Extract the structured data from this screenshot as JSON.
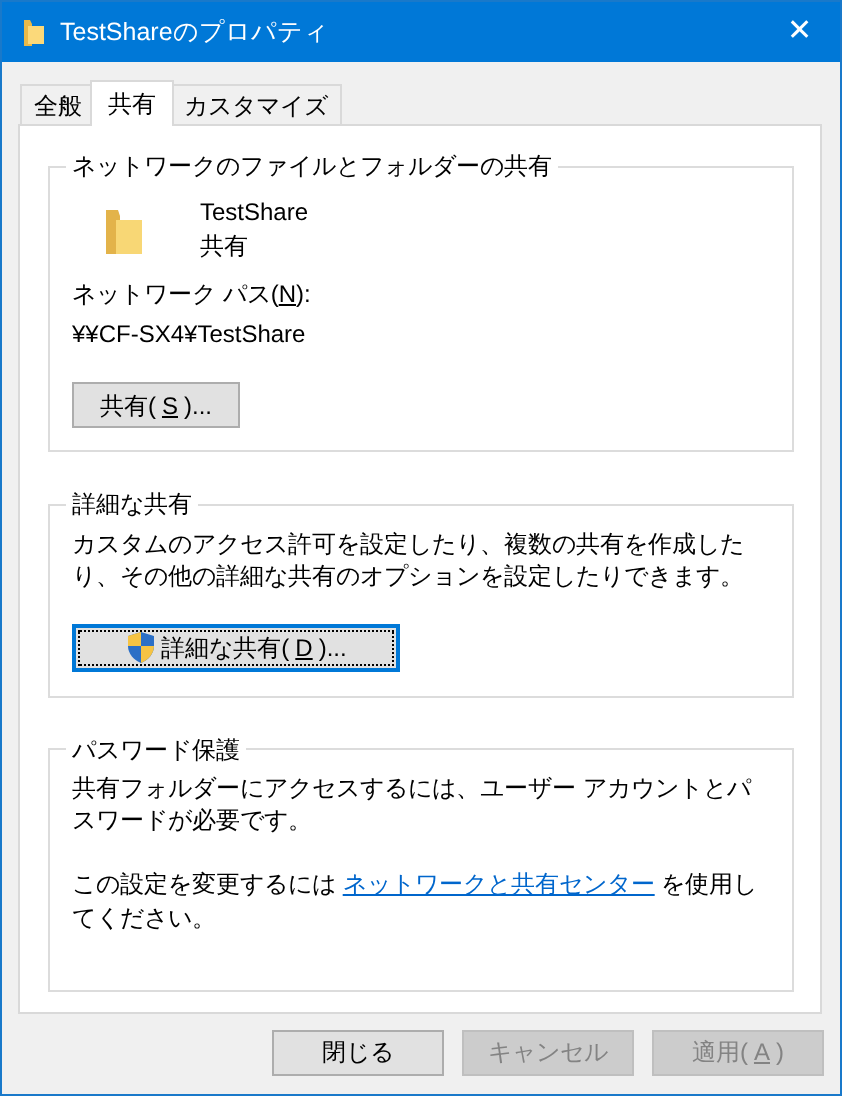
{
  "window": {
    "title": "TestShareのプロパティ",
    "close": "✕"
  },
  "tabs": [
    {
      "label": "全般",
      "selected": false
    },
    {
      "label": "共有",
      "selected": true
    },
    {
      "label": "カスタマイズ",
      "selected": false
    }
  ],
  "network_sharing": {
    "heading": "ネットワークのファイルとフォルダーの共有",
    "folder_name": "TestShare",
    "share_status": "共有",
    "path_label": {
      "before": "ネットワーク パス(",
      "key": "N",
      "after": "):"
    },
    "path": "¥¥CF-SX4¥TestShare",
    "button": {
      "before": "共有(",
      "key": "S",
      "after": ")...",
      "focused": false
    }
  },
  "advanced_sharing": {
    "heading": "詳細な共有",
    "description": "カスタムのアクセス許可を設定したり、複数の共有を作成したり、その他の詳細な共有のオプションを設定したりできます。",
    "button": {
      "before": "詳細な共有(",
      "key": "D",
      "after": ")...",
      "focused": true
    }
  },
  "password_protection": {
    "heading": "パスワード保護",
    "description": "共有フォルダーにアクセスするには、ユーザー アカウントとパスワードが必要です。",
    "change_note": {
      "before": "この設定を変更するには",
      "link": "ネットワークと共有センター",
      "after": "を使用してください。"
    }
  },
  "buttons": [
    {
      "before": "閉じる",
      "disabled": false
    },
    {
      "before": "キャンセル",
      "disabled": true
    },
    {
      "before": "適用(",
      "key": "A",
      "after": ")",
      "disabled": true
    }
  ]
}
